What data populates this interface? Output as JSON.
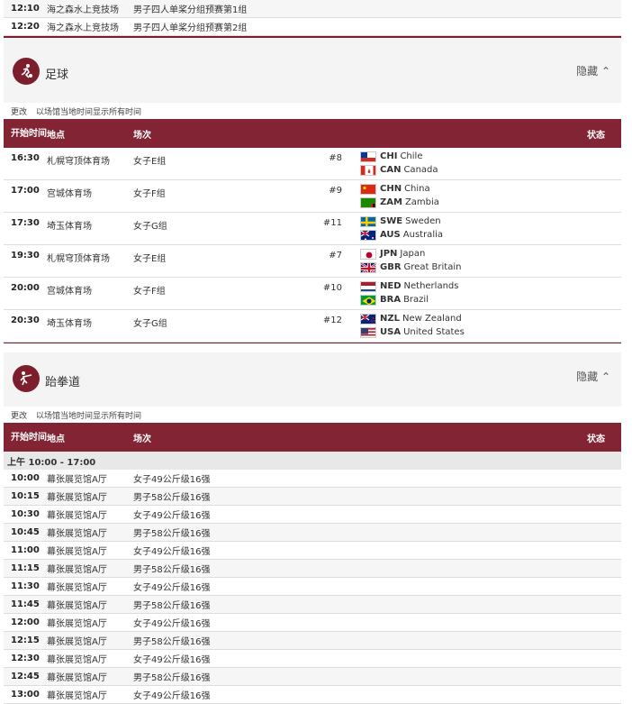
{
  "top_rows": [
    {
      "time": "12:10",
      "venue": "海之森水上竞技场",
      "event": "男子四人单桨分组预赛第1组"
    },
    {
      "time": "12:20",
      "venue": "海之森水上竞技场",
      "event": "男子四人单桨分组预赛第2组"
    }
  ],
  "football": {
    "title": "足球",
    "hide": "隐藏",
    "note_change": "更改",
    "note_text": "以场馆当地时间显示所有时间",
    "headers": {
      "time": "开始时间",
      "venue": "地点",
      "event": "场次",
      "status": "状态"
    },
    "rows": [
      {
        "time": "16:30",
        "venue": "札幌穹顶体育场",
        "event": "女子E组",
        "num": "#8",
        "teams": [
          {
            "code": "CHI",
            "name": "Chile",
            "flag": "chi"
          },
          {
            "code": "CAN",
            "name": "Canada",
            "flag": "can"
          }
        ]
      },
      {
        "time": "17:00",
        "venue": "宫城体育场",
        "event": "女子F组",
        "num": "#9",
        "teams": [
          {
            "code": "CHN",
            "name": "China",
            "flag": "chn"
          },
          {
            "code": "ZAM",
            "name": "Zambia",
            "flag": "zam"
          }
        ]
      },
      {
        "time": "17:30",
        "venue": "埼玉体育场",
        "event": "女子G组",
        "num": "#11",
        "teams": [
          {
            "code": "SWE",
            "name": "Sweden",
            "flag": "swe"
          },
          {
            "code": "AUS",
            "name": "Australia",
            "flag": "aus"
          }
        ]
      },
      {
        "time": "19:30",
        "venue": "札幌穹顶体育场",
        "event": "女子E组",
        "num": "#7",
        "teams": [
          {
            "code": "JPN",
            "name": "Japan",
            "flag": "jpn"
          },
          {
            "code": "GBR",
            "name": "Great Britain",
            "flag": "gbr"
          }
        ]
      },
      {
        "time": "20:00",
        "venue": "宫城体育场",
        "event": "女子F组",
        "num": "#10",
        "teams": [
          {
            "code": "NED",
            "name": "Netherlands",
            "flag": "ned"
          },
          {
            "code": "BRA",
            "name": "Brazil",
            "flag": "bra"
          }
        ]
      },
      {
        "time": "20:30",
        "venue": "埼玉体育场",
        "event": "女子G组",
        "num": "#12",
        "teams": [
          {
            "code": "NZL",
            "name": "New Zealand",
            "flag": "nzl"
          },
          {
            "code": "USA",
            "name": "United States",
            "flag": "usa"
          }
        ]
      }
    ]
  },
  "taekwondo": {
    "title": "跆拳道",
    "hide": "隐藏",
    "note_change": "更改",
    "note_text": "以场馆当地时间显示所有时间",
    "headers": {
      "time": "开始时间",
      "venue": "地点",
      "event": "场次",
      "status": "状态"
    },
    "period": "上午  10:00 - 17:00",
    "rows": [
      {
        "time": "10:00",
        "venue": "幕张展览馆A厅",
        "event": "女子49公斤级16强"
      },
      {
        "time": "10:15",
        "venue": "幕张展览馆A厅",
        "event": "男子58公斤级16强"
      },
      {
        "time": "10:30",
        "venue": "幕张展览馆A厅",
        "event": "女子49公斤级16强"
      },
      {
        "time": "10:45",
        "venue": "幕张展览馆A厅",
        "event": "男子58公斤级16强"
      },
      {
        "time": "11:00",
        "venue": "幕张展览馆A厅",
        "event": "女子49公斤级16强"
      },
      {
        "time": "11:15",
        "venue": "幕张展览馆A厅",
        "event": "男子58公斤级16强"
      },
      {
        "time": "11:30",
        "venue": "幕张展览馆A厅",
        "event": "女子49公斤级16强"
      },
      {
        "time": "11:45",
        "venue": "幕张展览馆A厅",
        "event": "男子58公斤级16强"
      },
      {
        "time": "12:00",
        "venue": "幕张展览馆A厅",
        "event": "女子49公斤级16强"
      },
      {
        "time": "12:15",
        "venue": "幕张展览馆A厅",
        "event": "男子58公斤级16强"
      },
      {
        "time": "12:30",
        "venue": "幕张展览馆A厅",
        "event": "女子49公斤级16强"
      },
      {
        "time": "12:45",
        "venue": "幕张展览馆A厅",
        "event": "男子58公斤级16强"
      },
      {
        "time": "13:00",
        "venue": "幕张展览馆A厅",
        "event": "女子49公斤级16强"
      }
    ]
  }
}
